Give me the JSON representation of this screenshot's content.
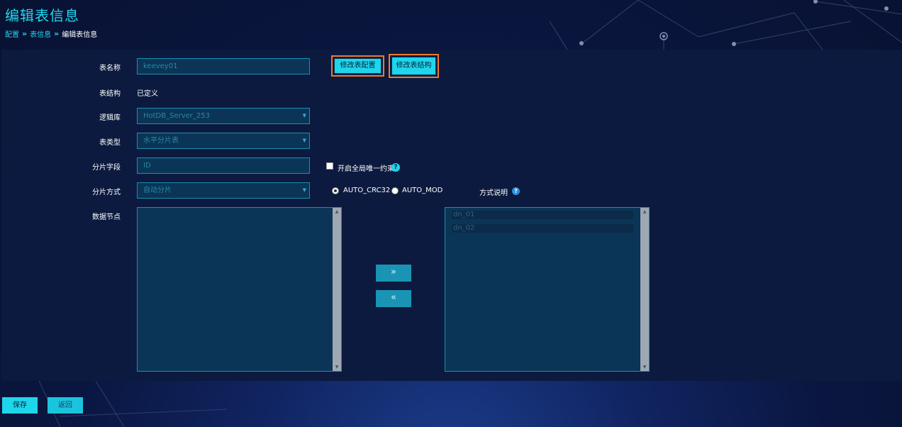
{
  "header": {
    "title": "编辑表信息",
    "breadcrumb": [
      "配置",
      "表信息",
      "编辑表信息"
    ]
  },
  "form": {
    "table_name": {
      "label": "表名称",
      "value": "keevey01"
    },
    "table_structure": {
      "label": "表结构",
      "value": "已定义"
    },
    "logic_db": {
      "label": "逻辑库",
      "value": "HotDB_Server_253"
    },
    "table_type": {
      "label": "表类型",
      "value": "水平分片表"
    },
    "shard_field": {
      "label": "分片字段",
      "value": "ID"
    },
    "shard_method": {
      "label": "分片方式",
      "value": "自动分片"
    },
    "data_nodes": {
      "label": "数据节点"
    }
  },
  "buttons": {
    "modify_config": "修改表配置",
    "modify_structure": "修改表结构",
    "move_right": "»",
    "move_left": "«",
    "save": "保存",
    "back": "返回"
  },
  "global_unique": {
    "label": "开启全局唯一约束",
    "checked": false,
    "help_icon": "question-icon"
  },
  "shard_algorithm": {
    "options": [
      "AUTO_CRC32",
      "AUTO_MOD"
    ],
    "selected": "AUTO_CRC32",
    "method_desc_label": "方式说明",
    "help_icon": "question-icon"
  },
  "available_nodes": [],
  "selected_nodes": [
    "dn_01",
    "dn_02"
  ],
  "colors": {
    "accent": "#1ed6ec",
    "highlight_border": "#f07a2a",
    "panel_bg": "#0b1a3e",
    "input_bg": "#0a3556"
  }
}
